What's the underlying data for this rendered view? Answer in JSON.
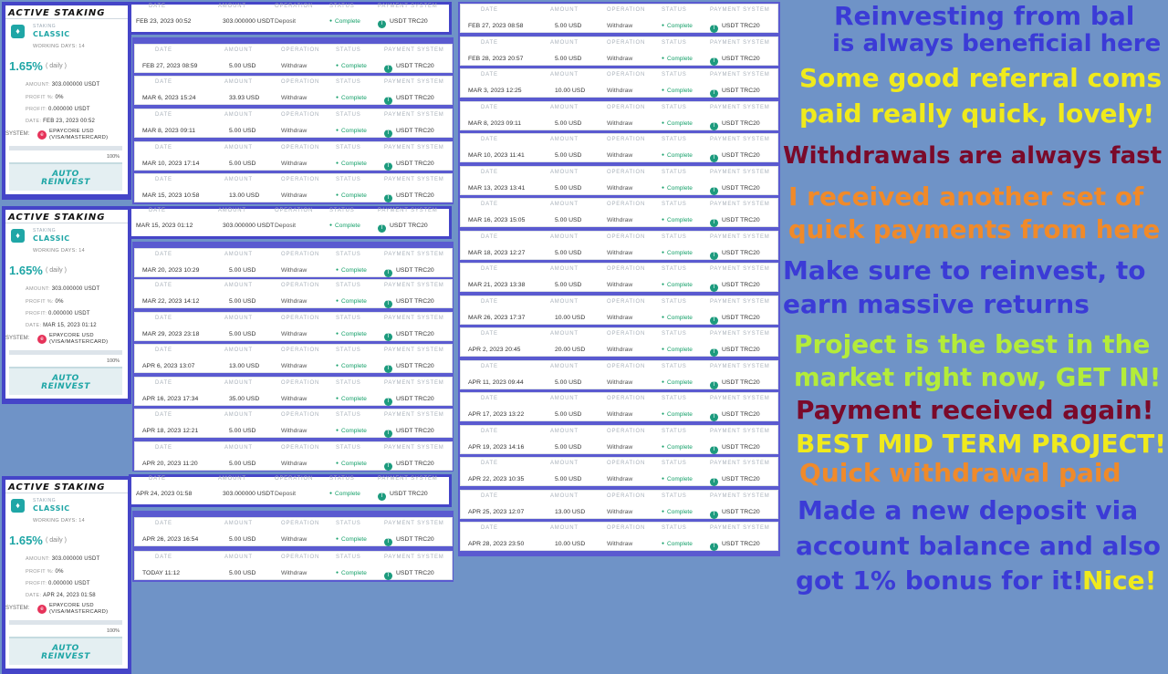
{
  "card_common": {
    "title": "ACTIVE STAKING",
    "plan_label": "STAKING",
    "plan_name": "CLASSIC",
    "working_days": "WORKING DAYS: 14",
    "rate": "1.65%",
    "period": "( daily )",
    "amount_label": "AMOUNT:",
    "amount_value": "303.000000 USDT",
    "profit_pct_label": "PROFIT %:",
    "profit_pct_value": "0%",
    "profit_label": "PROFIT:",
    "profit_value": "0.000000 USDT",
    "date_label": "DATE:",
    "system_label": "SYSTEM:",
    "system_line1": "EPAYCORE USD",
    "system_line2": "(VISA/MASTERCARD)",
    "progress": "100%",
    "auto_line1": "AUTO",
    "auto_line2": "REINVEST"
  },
  "cards": [
    {
      "date": "FEB 23, 2023 00:52"
    },
    {
      "date": "MAR 15, 2023 01:12"
    },
    {
      "date": "APR 24, 2023 01:58"
    }
  ],
  "headers": {
    "date": "DATE",
    "amount": "AMOUNT",
    "operation": "OPERATION",
    "status": "STATUS",
    "payment": "PAYMENT SYSTEM"
  },
  "status_value": "Complete",
  "payment_value": "USDT TRC20",
  "deposits": [
    {
      "date": "FEB 23, 2023 00:52",
      "amount": "303.000000 USDT",
      "op": "Deposit"
    },
    {
      "date": "MAR 15, 2023 01:12",
      "amount": "303.000000 USDT",
      "op": "Deposit"
    },
    {
      "date": "APR 24, 2023 01:58",
      "amount": "303.000000 USDT",
      "op": "Deposit"
    }
  ],
  "middle_rows": [
    {
      "date": "FEB 27, 2023 08:59",
      "amount": "5.00 USD",
      "op": "Withdraw"
    },
    {
      "date": "MAR 6, 2023 15:24",
      "amount": "33.93 USD",
      "op": "Withdraw"
    },
    {
      "date": "MAR 8, 2023 09:11",
      "amount": "5.00 USD",
      "op": "Withdraw"
    },
    {
      "date": "MAR 10, 2023 17:14",
      "amount": "5.00 USD",
      "op": "Withdraw"
    },
    {
      "date": "MAR 15, 2023 10:58",
      "amount": "13.00 USD",
      "op": "Withdraw"
    },
    {
      "date": "MAR 20, 2023 10:29",
      "amount": "5.00 USD",
      "op": "Withdraw"
    },
    {
      "date": "MAR 22, 2023 14:12",
      "amount": "5.00 USD",
      "op": "Withdraw"
    },
    {
      "date": "MAR 29, 2023 23:18",
      "amount": "5.00 USD",
      "op": "Withdraw"
    },
    {
      "date": "APR 6, 2023 13:07",
      "amount": "13.00 USD",
      "op": "Withdraw"
    },
    {
      "date": "APR 16, 2023 17:34",
      "amount": "35.00 USD",
      "op": "Withdraw"
    },
    {
      "date": "APR 18, 2023 12:21",
      "amount": "5.00 USD",
      "op": "Withdraw"
    },
    {
      "date": "APR 20, 2023 11:20",
      "amount": "5.00 USD",
      "op": "Withdraw"
    },
    {
      "date": "APR 26, 2023 16:54",
      "amount": "5.00 USD",
      "op": "Withdraw"
    },
    {
      "date": "TODAY 11:12",
      "amount": "5.00 USD",
      "op": "Withdraw"
    }
  ],
  "right_rows": [
    {
      "date": "FEB 27, 2023 08:58",
      "amount": "5.00 USD",
      "op": "Withdraw"
    },
    {
      "date": "FEB 28, 2023 20:57",
      "amount": "5.00 USD",
      "op": "Withdraw"
    },
    {
      "date": "MAR 3, 2023 12:25",
      "amount": "10.00 USD",
      "op": "Withdraw"
    },
    {
      "date": "MAR 8, 2023 09:11",
      "amount": "5.00 USD",
      "op": "Withdraw"
    },
    {
      "date": "MAR 10, 2023 11:41",
      "amount": "5.00 USD",
      "op": "Withdraw"
    },
    {
      "date": "MAR 13, 2023 13:41",
      "amount": "5.00 USD",
      "op": "Withdraw"
    },
    {
      "date": "MAR 16, 2023 15:05",
      "amount": "5.00 USD",
      "op": "Withdraw"
    },
    {
      "date": "MAR 18, 2023 12:27",
      "amount": "5.00 USD",
      "op": "Withdraw"
    },
    {
      "date": "MAR 21, 2023 13:38",
      "amount": "5.00 USD",
      "op": "Withdraw"
    },
    {
      "date": "MAR 26, 2023 17:37",
      "amount": "10.00 USD",
      "op": "Withdraw"
    },
    {
      "date": "APR 2, 2023 20:45",
      "amount": "20.00 USD",
      "op": "Withdraw"
    },
    {
      "date": "APR 11, 2023 09:44",
      "amount": "5.00 USD",
      "op": "Withdraw"
    },
    {
      "date": "APR 17, 2023 13:22",
      "amount": "5.00 USD",
      "op": "Withdraw"
    },
    {
      "date": "APR 19, 2023 14:16",
      "amount": "5.00 USD",
      "op": "Withdraw"
    },
    {
      "date": "APR 22, 2023 10:35",
      "amount": "5.00 USD",
      "op": "Withdraw"
    },
    {
      "date": "APR 25, 2023 12:07",
      "amount": "13.00 USD",
      "op": "Withdraw"
    },
    {
      "date": "APR 28, 2023 23:50",
      "amount": "10.00 USD",
      "op": "Withdraw"
    }
  ],
  "captions": [
    {
      "text": "Reinvesting from bal",
      "color": "#3b3bd6"
    },
    {
      "text": "is always beneficial here",
      "color": "#3b3bd6"
    },
    {
      "text": "Some good referral coms",
      "color": "#f0ea1c"
    },
    {
      "text": "paid really quick, lovely!",
      "color": "#f0ea1c"
    },
    {
      "text": "Withdrawals are always fast",
      "color": "#7a0a2a"
    },
    {
      "text": "I received another set of",
      "color": "#f08a2a"
    },
    {
      "text": "quick payments from here",
      "color": "#f08a2a"
    },
    {
      "text": "Make sure to reinvest, to",
      "color": "#3b3bd6"
    },
    {
      "text": "earn massive returns",
      "color": "#3b3bd6"
    },
    {
      "text": "Project is the best in the",
      "color": "#b4ec3a"
    },
    {
      "text": "market right now, GET IN!",
      "color": "#b4ec3a"
    },
    {
      "text": "Payment received again!",
      "color": "#7a0a2a"
    },
    {
      "text": "BEST MID TERM PROJECT!",
      "color": "#f0ea1c"
    },
    {
      "text": "Quick withdrawal paid",
      "color": "#f08a2a"
    },
    {
      "text": "Made a new deposit via",
      "color": "#3b3bd6"
    },
    {
      "text": "account balance and also",
      "color": "#3b3bd6"
    },
    {
      "text": "got 1% bonus for it!",
      "color": "#3b3bd6"
    },
    {
      "text": "Nice!",
      "color": "#f0ea1c"
    }
  ],
  "icons": {
    "plan": "shield-icon",
    "system": "epaycore-icon",
    "payment": "tether-icon"
  }
}
